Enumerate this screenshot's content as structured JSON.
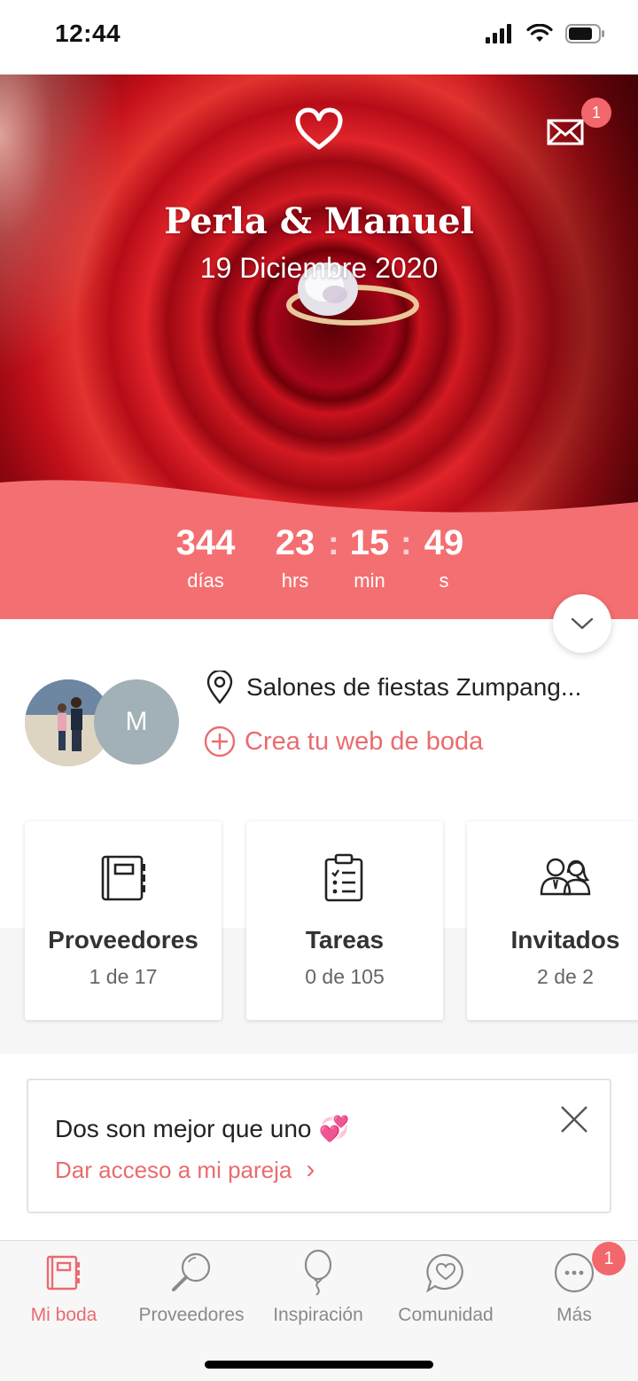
{
  "status_bar": {
    "time": "12:44"
  },
  "hero": {
    "couple_names": "Perla & Manuel",
    "wedding_date": "19 Diciembre 2020",
    "mail_badge": "1"
  },
  "countdown": {
    "days": "344",
    "days_label": "días",
    "hours": "23",
    "hours_label": "hrs",
    "minutes": "15",
    "minutes_label": "min",
    "seconds": "49",
    "seconds_label": "s",
    "separator": ":"
  },
  "couple": {
    "partner_initial": "M",
    "venue": "Salones de fiestas Zumpang...",
    "create_web": "Crea tu web de boda"
  },
  "cards": [
    {
      "title": "Proveedores",
      "subtitle": "1 de 17",
      "icon": "notebook-icon"
    },
    {
      "title": "Tareas",
      "subtitle": "0 de 105",
      "icon": "checklist-icon"
    },
    {
      "title": "Invitados",
      "subtitle": "2 de 2",
      "icon": "guests-icon"
    }
  ],
  "promo": {
    "title": "Dos son mejor que uno",
    "emoji": "💞",
    "link": "Dar acceso a mi pareja",
    "chevron": "›"
  },
  "tabbar": {
    "items": [
      {
        "label": "Mi boda",
        "icon": "planner-icon",
        "active": true
      },
      {
        "label": "Proveedores",
        "icon": "magnifier-icon",
        "active": false
      },
      {
        "label": "Inspiración",
        "icon": "balloon-icon",
        "active": false
      },
      {
        "label": "Comunidad",
        "icon": "chat-heart-icon",
        "active": false
      },
      {
        "label": "Más",
        "icon": "more-icon",
        "active": false
      }
    ],
    "more_badge": "1"
  },
  "colors": {
    "accent": "#ea6b6f",
    "band": "#f46f71",
    "badge": "#f2676b"
  }
}
